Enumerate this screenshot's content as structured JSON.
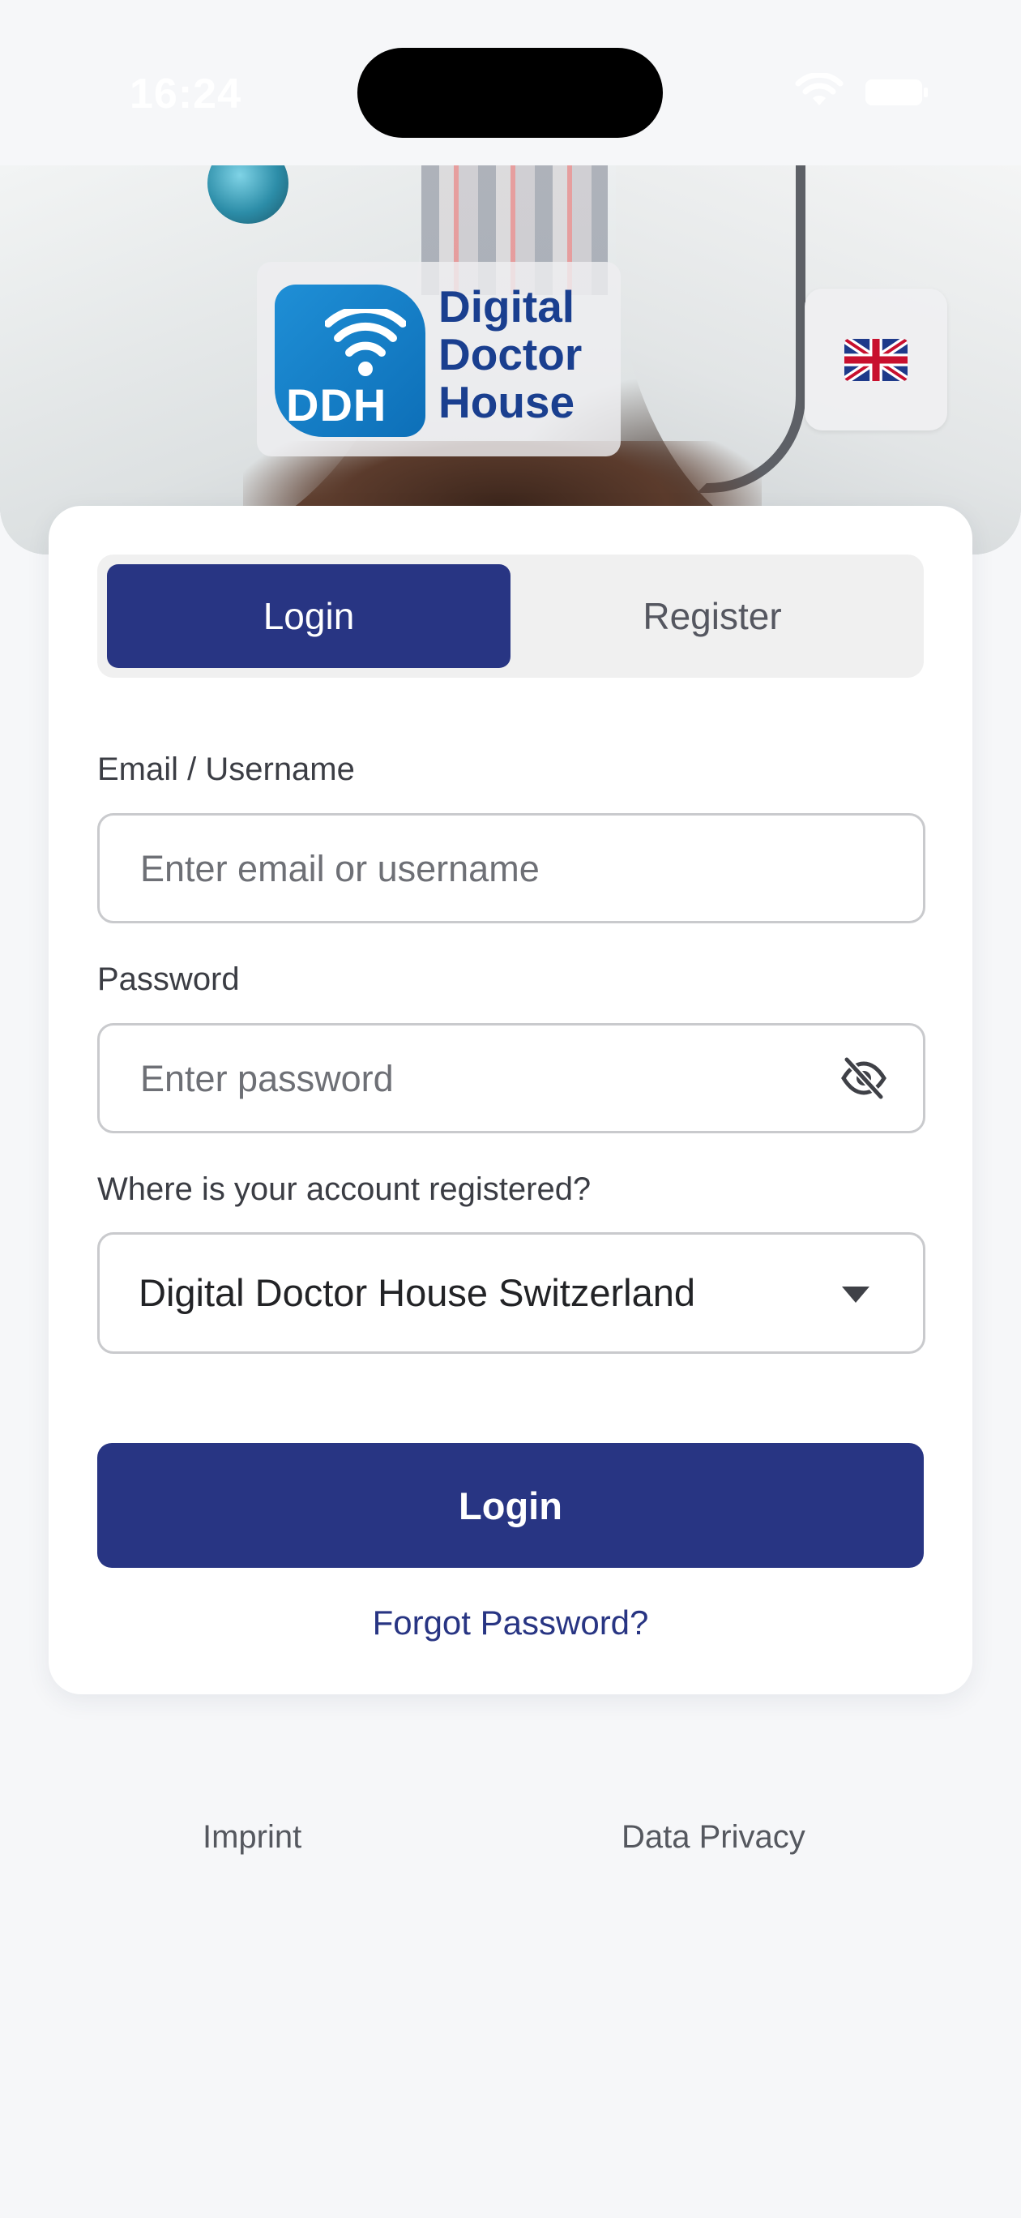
{
  "status_bar": {
    "time": "16:24"
  },
  "brand": {
    "badge_text": "DDH",
    "name_lines": [
      "Digital",
      "Doctor",
      "House"
    ],
    "colors": {
      "primary": "#283583",
      "badge_blue": "#1f8fd6",
      "logo_text": "#1a3f8f"
    }
  },
  "language": {
    "icon": "uk-flag-icon"
  },
  "tabs": {
    "login_label": "Login",
    "register_label": "Register",
    "active": "Login"
  },
  "form": {
    "email_label": "Email / Username",
    "email_placeholder": "Enter email or username",
    "email_value": "",
    "password_label": "Password",
    "password_placeholder": "Enter password",
    "password_value": "",
    "password_toggle_icon": "eye-off-icon",
    "region_label": "Where is your account registered?",
    "region_value": "Digital Doctor House Switzerland",
    "submit_label": "Login",
    "forgot_label": "Forgot Password?"
  },
  "footer": {
    "imprint_label": "Imprint",
    "privacy_label": "Data Privacy"
  }
}
